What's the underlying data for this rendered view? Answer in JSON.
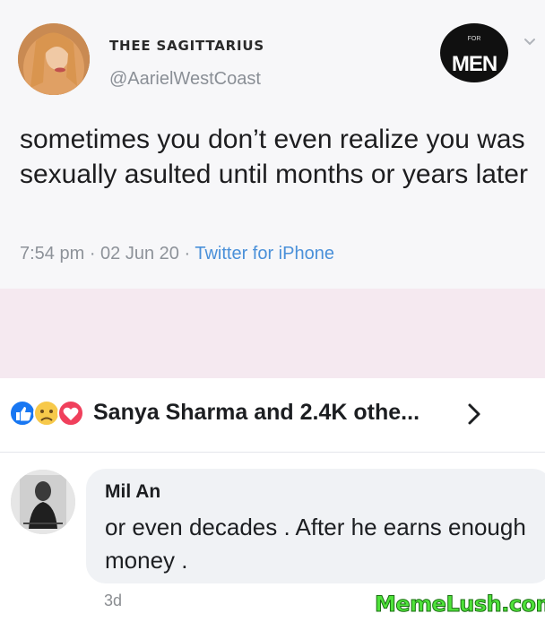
{
  "tweet": {
    "display_name": "THEE SAGITTARIUS",
    "handle": "@AarielWestCoast",
    "text": "sometimes you don’t even realize you was sexually asulted until months or years later",
    "time": "7:54 pm",
    "date": "02 Jun 20",
    "source": "Twitter for iPhone",
    "brand_logo_small": "FOR",
    "brand_logo_text": "MEN"
  },
  "reactions": {
    "summary": "Sanya Sharma and 2.4K othe...",
    "icons": [
      "like-icon",
      "sad-icon",
      "love-icon"
    ]
  },
  "comment": {
    "author": "Mil An",
    "text": "or even decades . After he earns enough money .",
    "time": "3d"
  },
  "watermark": "MemeLush.com",
  "colors": {
    "tweet_bg": "#f7f7f9",
    "pink_band": "#f5e9f0",
    "link_blue": "#4a90d9",
    "comment_bubble": "#f0f2f5",
    "watermark_green": "#4fe23a"
  }
}
